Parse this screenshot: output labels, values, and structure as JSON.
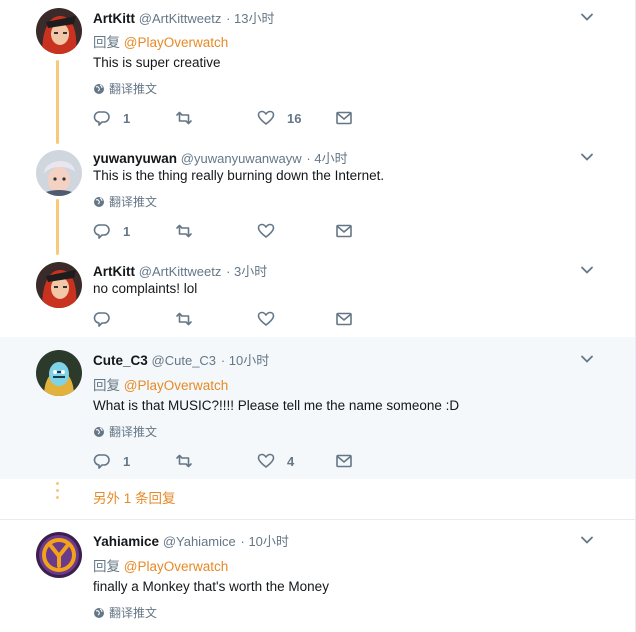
{
  "tweets": [
    {
      "name": "ArtKitt",
      "handle": "@ArtKittweetz",
      "time": "· 13小时",
      "reply_prefix": "回复",
      "reply_mention": "@PlayOverwatch",
      "text": "This is super creative",
      "translate": "翻译推文",
      "reply_count": "1",
      "retweet_count": "",
      "like_count": "16"
    },
    {
      "name": "yuwanyuwan",
      "handle": "@yuwanyuwanwayw",
      "time": "· 4小时",
      "text": "This is the thing really burning down the Internet.",
      "translate": "翻译推文",
      "reply_count": "1",
      "retweet_count": "",
      "like_count": ""
    },
    {
      "name": "ArtKitt",
      "handle": "@ArtKittweetz",
      "time": "· 3小时",
      "text": "no complaints! lol",
      "reply_count": "",
      "retweet_count": "",
      "like_count": ""
    },
    {
      "name": "Cute_C3",
      "handle": "@Cute_C3",
      "time": "· 10小时",
      "reply_prefix": "回复",
      "reply_mention": "@PlayOverwatch",
      "text": "What is that MUSIC?!!!! Please tell me the name someone :D",
      "translate": "翻译推文",
      "reply_count": "1",
      "retweet_count": "",
      "like_count": "4"
    },
    {
      "name": "Yahiamice",
      "handle": "@Yahiamice",
      "time": "· 10小时",
      "reply_prefix": "回复",
      "reply_mention": "@PlayOverwatch",
      "text": "finally a Monkey that's worth the Money",
      "translate": "翻译推文"
    }
  ],
  "more_replies": "另外 1 条回复",
  "icons": {
    "reply": "reply-icon",
    "retweet": "retweet-icon",
    "like": "heart-icon",
    "dm": "envelope-icon",
    "caret": "chevron-down-icon",
    "globe": "globe-icon"
  },
  "colors": {
    "accent": "#e68a27",
    "thread": "#f8c978",
    "muted": "#657786",
    "highlight_bg": "#f5f8fa"
  }
}
